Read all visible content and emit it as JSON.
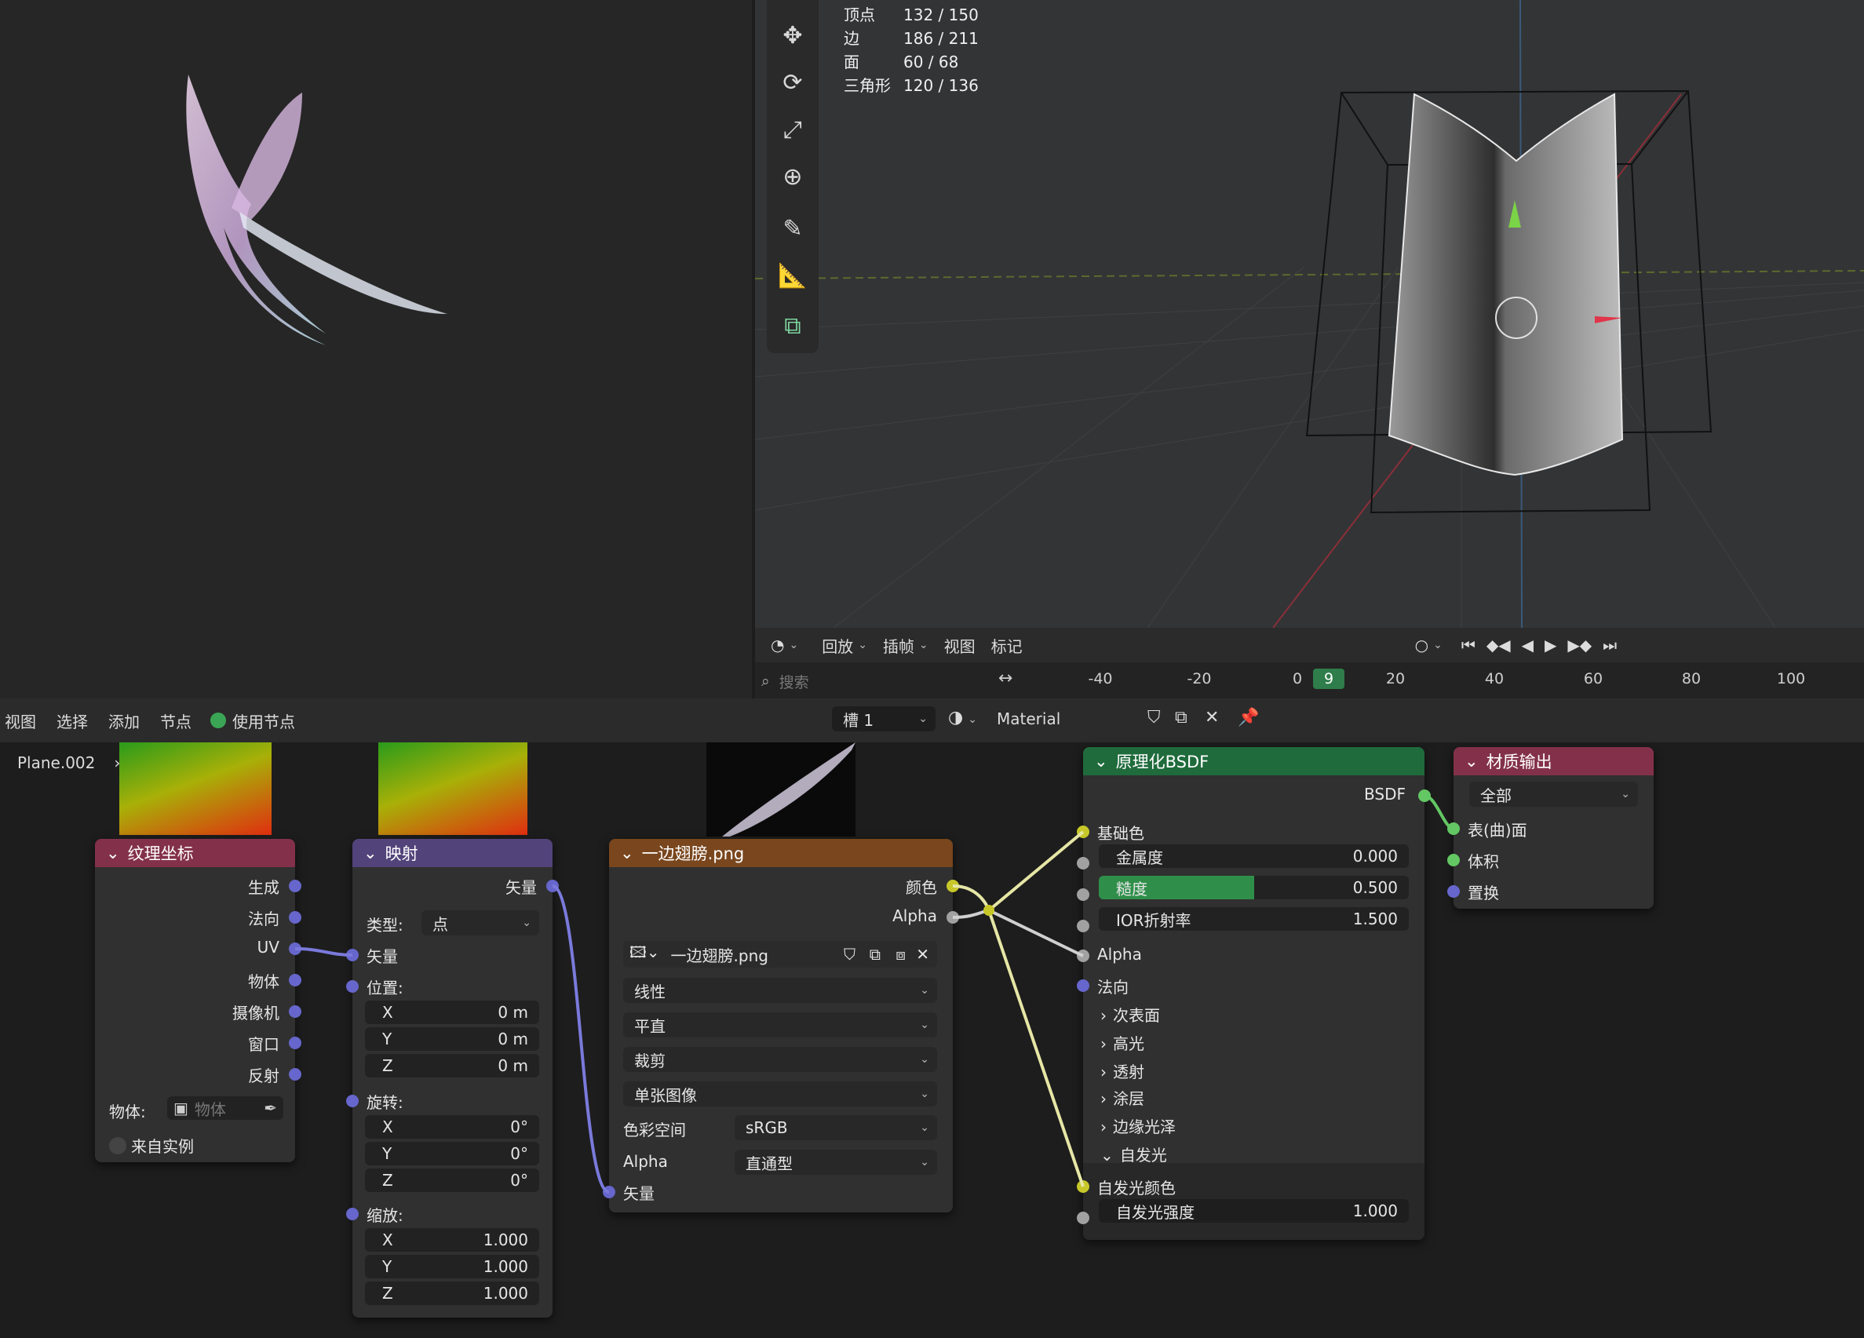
{
  "stats": {
    "rows": [
      {
        "label": "顶点",
        "value": "132 / 150"
      },
      {
        "label": "边",
        "value": "186 / 211"
      },
      {
        "label": "面",
        "value": "60 / 68"
      },
      {
        "label": "三角形",
        "value": "120 / 136"
      }
    ]
  },
  "timeline": {
    "menus": [
      "回放",
      "插帧",
      "视图",
      "标记"
    ],
    "search_placeholder": "搜索",
    "ticks": [
      "-40",
      "-20",
      "0",
      "9",
      "20",
      "40",
      "60",
      "80",
      "100"
    ],
    "current_frame": "9"
  },
  "node_header": {
    "menus": [
      "视图",
      "选择",
      "添加",
      "节点"
    ],
    "use_nodes": "使用节点",
    "slot": "槽 1",
    "material": "Material",
    "object": "Plane.002"
  },
  "nodes": {
    "texcoord": {
      "title": "纹理坐标",
      "outputs": [
        "生成",
        "法向",
        "UV",
        "物体",
        "摄像机",
        "窗口",
        "反射"
      ],
      "object_label": "物体:",
      "object_placeholder": "物体",
      "from_instancer": "来自实例"
    },
    "mapping": {
      "title": "映射",
      "output": "矢量",
      "type_label": "类型:",
      "type_value": "点",
      "vector": "矢量",
      "location": "位置:",
      "rotation": "旋转:",
      "scale": "缩放:",
      "loc": [
        {
          "axis": "X",
          "value": "0 m"
        },
        {
          "axis": "Y",
          "value": "0 m"
        },
        {
          "axis": "Z",
          "value": "0 m"
        }
      ],
      "rot": [
        {
          "axis": "X",
          "value": "0°"
        },
        {
          "axis": "Y",
          "value": "0°"
        },
        {
          "axis": "Z",
          "value": "0°"
        }
      ],
      "scl": [
        {
          "axis": "X",
          "value": "1.000"
        },
        {
          "axis": "Y",
          "value": "1.000"
        },
        {
          "axis": "Z",
          "value": "1.000"
        }
      ]
    },
    "image": {
      "title": "一边翅膀.png",
      "out_color": "颜色",
      "out_alpha": "Alpha",
      "filename": "一边翅膀.png",
      "interp": "线性",
      "projection": "平直",
      "extension": "裁剪",
      "source": "单张图像",
      "colorspace_label": "色彩空间",
      "colorspace": "sRGB",
      "alpha_label": "Alpha",
      "alpha": "直通型",
      "vector": "矢量"
    },
    "bsdf": {
      "title": "原理化BSDF",
      "output": "BSDF",
      "base_color": "基础色",
      "metallic_label": "金属度",
      "metallic": "0.000",
      "roughness_label": "糙度",
      "roughness": "0.500",
      "ior_label": "IOR折射率",
      "ior": "1.500",
      "alpha": "Alpha",
      "normal": "法向",
      "panels": [
        "次表面",
        "高光",
        "透射",
        "涂层",
        "边缘光泽"
      ],
      "emission_panel": "自发光",
      "emission_color": "自发光颜色",
      "emission_strength_label": "自发光强度",
      "emission_strength": "1.000"
    },
    "output": {
      "title": "材质输出",
      "target": "全部",
      "surface": "表(曲)面",
      "volume": "体积",
      "displacement": "置换"
    }
  },
  "colors": {
    "texcoord_header": "#83314a",
    "mapping_header": "#52437a",
    "image_header": "#79461d",
    "bsdf_header": "#1f6b3c",
    "output_header": "#83314a"
  }
}
